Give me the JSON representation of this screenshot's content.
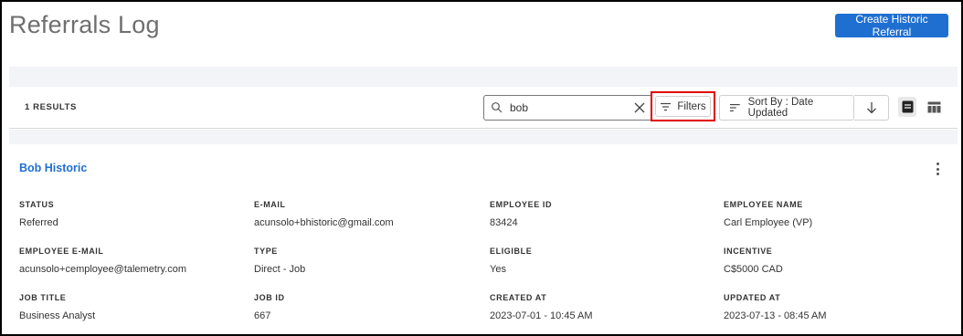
{
  "header": {
    "title": "Referrals Log",
    "create_button": "Create Historic Referral"
  },
  "toolbar": {
    "results": "1 RESULTS",
    "search_value": "bob",
    "filters_label": "Filters",
    "sort_label": "Sort By : Date Updated"
  },
  "record": {
    "name": "Bob Historic",
    "fields": [
      {
        "label": "STATUS",
        "value": "Referred"
      },
      {
        "label": "E-MAIL",
        "value": "acunsolo+bhistoric@gmail.com"
      },
      {
        "label": "EMPLOYEE ID",
        "value": "83424"
      },
      {
        "label": "EMPLOYEE NAME",
        "value": "Carl Employee (VP)"
      },
      {
        "label": "EMPLOYEE E-MAIL",
        "value": "acunsolo+cemployee@talemetry.com"
      },
      {
        "label": "TYPE",
        "value": "Direct - Job"
      },
      {
        "label": "ELIGIBLE",
        "value": "Yes"
      },
      {
        "label": "INCENTIVE",
        "value": "C$5000 CAD"
      },
      {
        "label": "JOB TITLE",
        "value": "Business Analyst"
      },
      {
        "label": "JOB ID",
        "value": "667"
      },
      {
        "label": "CREATED AT",
        "value": "2023-07-01 - 10:45 AM"
      },
      {
        "label": "UPDATED AT",
        "value": "2023-07-13 - 08:45 AM"
      }
    ]
  },
  "colors": {
    "accent": "#1f6fd1",
    "highlight_box": "#e00000",
    "band": "#f2f4f8"
  },
  "icons": [
    "search-icon",
    "clear-icon",
    "filter-icon",
    "sort-lines-icon",
    "arrow-down-icon",
    "list-view-icon",
    "table-view-icon",
    "more-vert-icon"
  ]
}
